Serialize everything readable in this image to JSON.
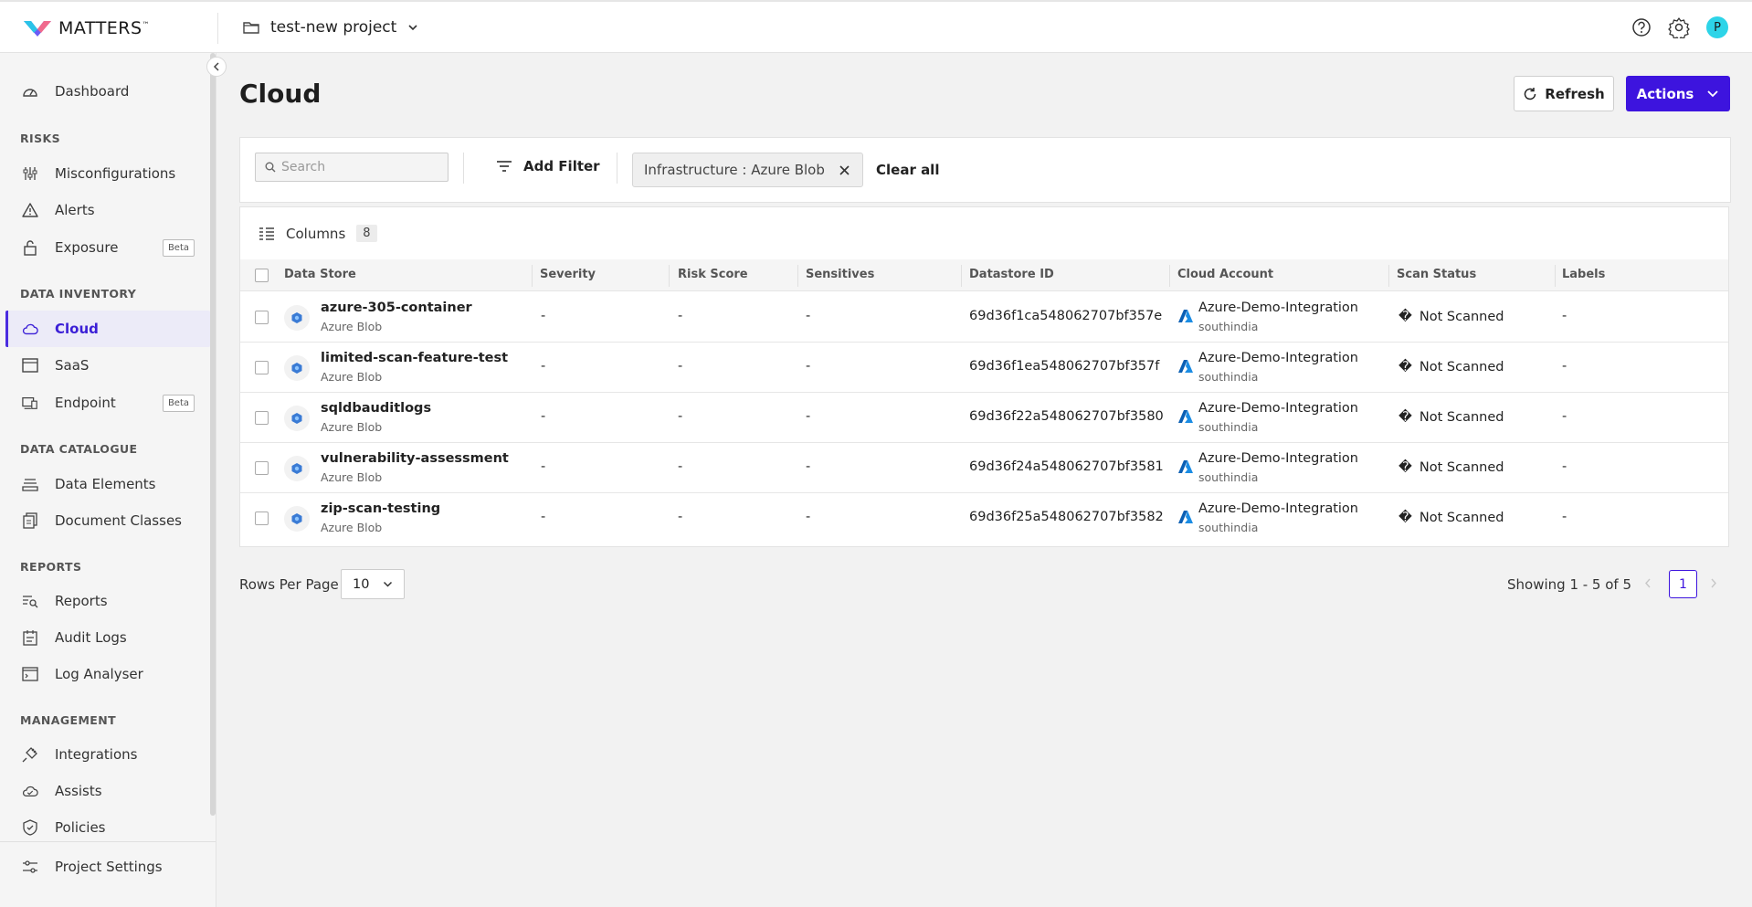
{
  "brand": {
    "name": "MATTERS",
    "tm": "™"
  },
  "project": {
    "name": "test-new project"
  },
  "header": {
    "avatar_initial": "P"
  },
  "sidebar": {
    "items_top": [
      {
        "label": "Dashboard",
        "icon": "dashboard-gauge-icon"
      }
    ],
    "sections": [
      {
        "title": "RISKS",
        "items": [
          {
            "label": "Misconfigurations",
            "icon": "sliders-icon"
          },
          {
            "label": "Alerts",
            "icon": "warning-triangle-icon"
          },
          {
            "label": "Exposure",
            "icon": "lock-open-icon",
            "badge": "Beta"
          }
        ]
      },
      {
        "title": "DATA INVENTORY",
        "items": [
          {
            "label": "Cloud",
            "icon": "cloud-icon",
            "active": true
          },
          {
            "label": "SaaS",
            "icon": "window-icon"
          },
          {
            "label": "Endpoint",
            "icon": "devices-icon",
            "badge": "Beta"
          }
        ]
      },
      {
        "title": "DATA CATALOGUE",
        "items": [
          {
            "label": "Data Elements",
            "icon": "layers-icon"
          },
          {
            "label": "Document Classes",
            "icon": "documents-icon"
          }
        ]
      },
      {
        "title": "REPORTS",
        "items": [
          {
            "label": "Reports",
            "icon": "report-search-icon"
          },
          {
            "label": "Audit Logs",
            "icon": "calendar-log-icon"
          },
          {
            "label": "Log Analyser",
            "icon": "terminal-icon"
          }
        ]
      },
      {
        "title": "MANAGEMENT",
        "items": [
          {
            "label": "Integrations",
            "icon": "plug-icon"
          },
          {
            "label": "Assists",
            "icon": "cloud-check-icon"
          },
          {
            "label": "Policies",
            "icon": "shield-check-icon"
          }
        ]
      }
    ],
    "footer": {
      "label": "Project Settings",
      "icon": "settings-sliders-icon"
    }
  },
  "main": {
    "title": "Cloud",
    "refresh_label": "Refresh",
    "actions_label": "Actions",
    "search_placeholder": "Search",
    "add_filter_label": "Add Filter",
    "filter_chip": "Infrastructure : Azure Blob",
    "clear_all_label": "Clear all",
    "columns_label": "Columns",
    "columns_count": "8"
  },
  "table": {
    "headers": [
      "Data Store",
      "Severity",
      "Risk Score",
      "Sensitives",
      "Datastore ID",
      "Cloud Account",
      "Scan Status",
      "Labels"
    ],
    "rows": [
      {
        "name": "azure-305-container",
        "type": "Azure Blob",
        "severity": "-",
        "risk": "-",
        "sensitives": "-",
        "id": "69d36f1ca548062707bf357e",
        "account": "Azure-Demo-Integration",
        "region": "southindia",
        "scan_icon": "�",
        "scan": "Not Scanned",
        "labels": "-"
      },
      {
        "name": "limited-scan-feature-test",
        "type": "Azure Blob",
        "severity": "-",
        "risk": "-",
        "sensitives": "-",
        "id": "69d36f1ea548062707bf357f",
        "account": "Azure-Demo-Integration",
        "region": "southindia",
        "scan_icon": "�",
        "scan": "Not Scanned",
        "labels": "-"
      },
      {
        "name": "sqldbauditlogs",
        "type": "Azure Blob",
        "severity": "-",
        "risk": "-",
        "sensitives": "-",
        "id": "69d36f22a548062707bf3580",
        "account": "Azure-Demo-Integration",
        "region": "southindia",
        "scan_icon": "�",
        "scan": "Not Scanned",
        "labels": "-"
      },
      {
        "name": "vulnerability-assessment",
        "type": "Azure Blob",
        "severity": "-",
        "risk": "-",
        "sensitives": "-",
        "id": "69d36f24a548062707bf3581",
        "account": "Azure-Demo-Integration",
        "region": "southindia",
        "scan_icon": "�",
        "scan": "Not Scanned",
        "labels": "-"
      },
      {
        "name": "zip-scan-testing",
        "type": "Azure Blob",
        "severity": "-",
        "risk": "-",
        "sensitives": "-",
        "id": "69d36f25a548062707bf3582",
        "account": "Azure-Demo-Integration",
        "region": "southindia",
        "scan_icon": "�",
        "scan": "Not Scanned",
        "labels": "-"
      }
    ]
  },
  "pagination": {
    "rows_label": "Rows Per Page",
    "rows_value": "10",
    "showing": "Showing 1 - 5 of 5",
    "current_page": "1"
  },
  "colors": {
    "accent": "#3d14de",
    "active_bg": "#ecebf8",
    "azure_blue": "#0078d4"
  }
}
